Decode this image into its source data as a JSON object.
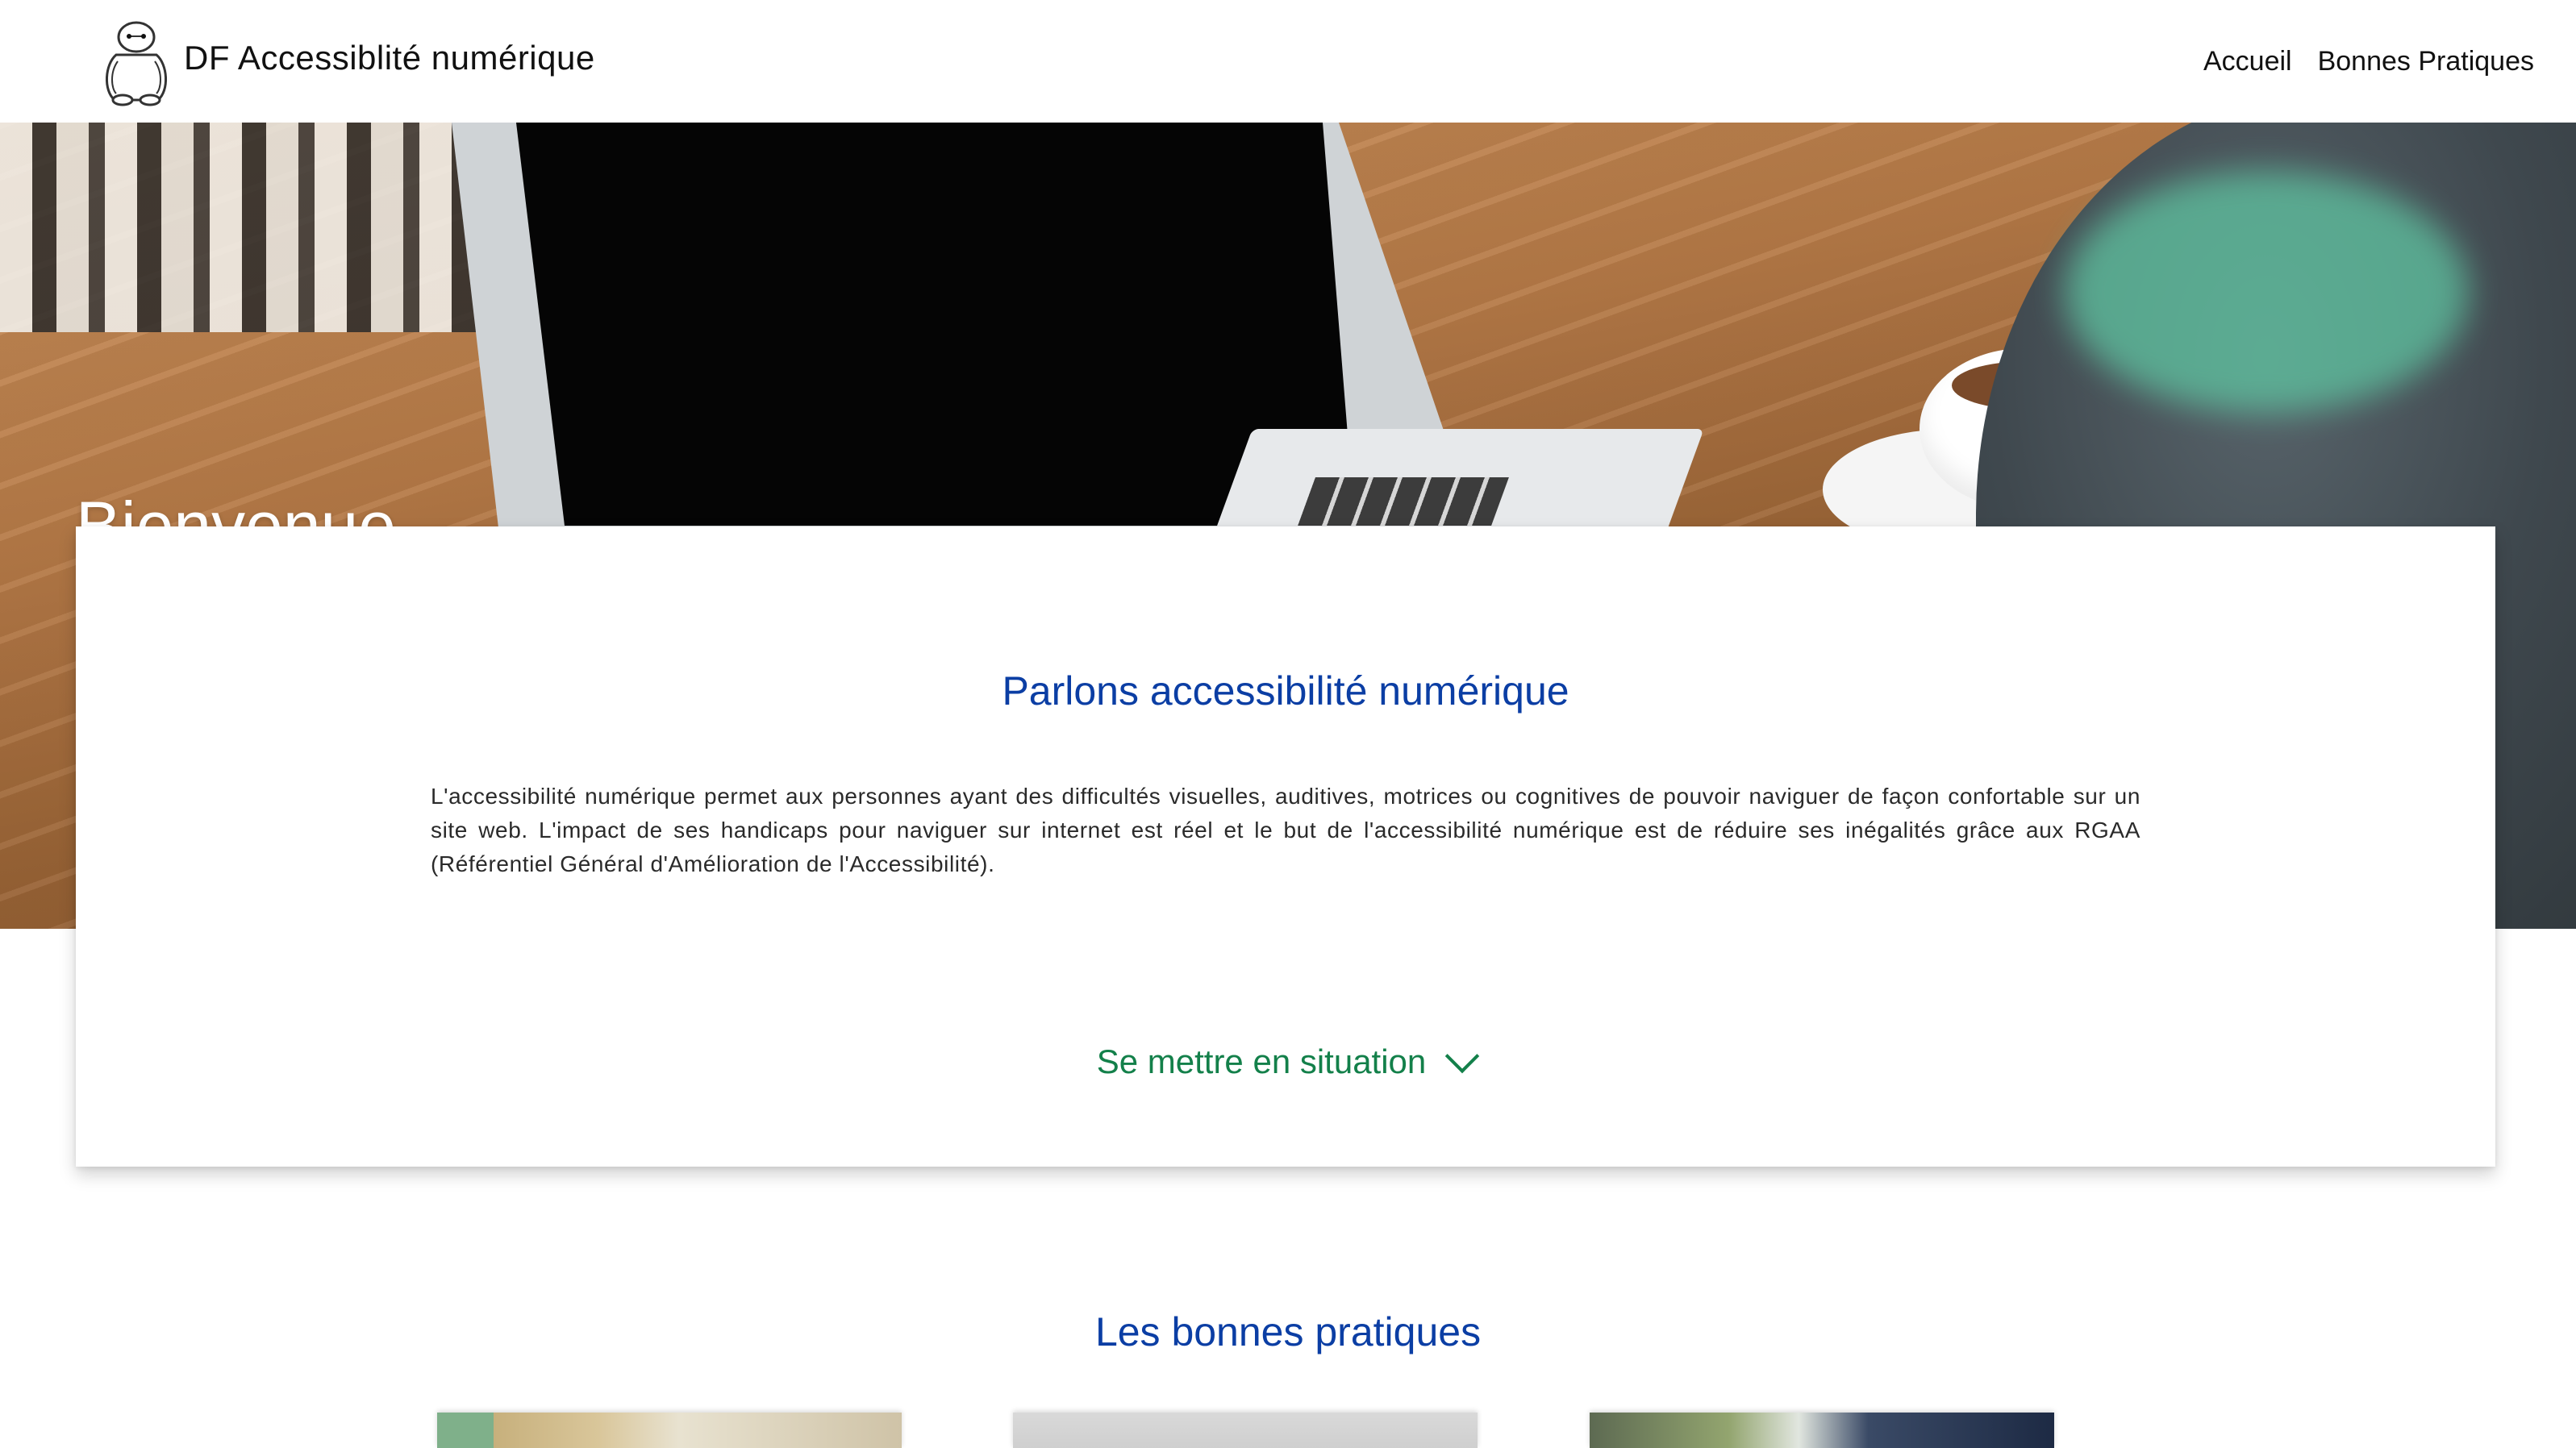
{
  "header": {
    "brand": "DF Accessiblité numérique",
    "logo_icon": "robot-mascot-icon",
    "nav": [
      {
        "label": "Accueil"
      },
      {
        "label": "Bonnes Pratiques"
      }
    ]
  },
  "hero": {
    "title": "Bienvenue"
  },
  "intro": {
    "title": "Parlons accessibilité numérique",
    "text": "L'accessibilité numérique permet aux personnes ayant des difficultés visuelles, auditives, motrices ou cognitives de pouvoir naviguer de façon confortable sur un site web. L'impact de ses handicaps pour naviguer sur internet est réel et le but de l'accessibilité numérique est de réduire ses inégalités grâce aux RGAA (Référentiel Général d'Amélioration de l'Accessibilité).",
    "situation_label": "Se mettre en situation",
    "situation_icon": "chevron-down-icon"
  },
  "practices": {
    "title": "Les bonnes pratiques"
  },
  "colors": {
    "title_blue": "#0b3ea4",
    "link_green": "#13804a"
  }
}
